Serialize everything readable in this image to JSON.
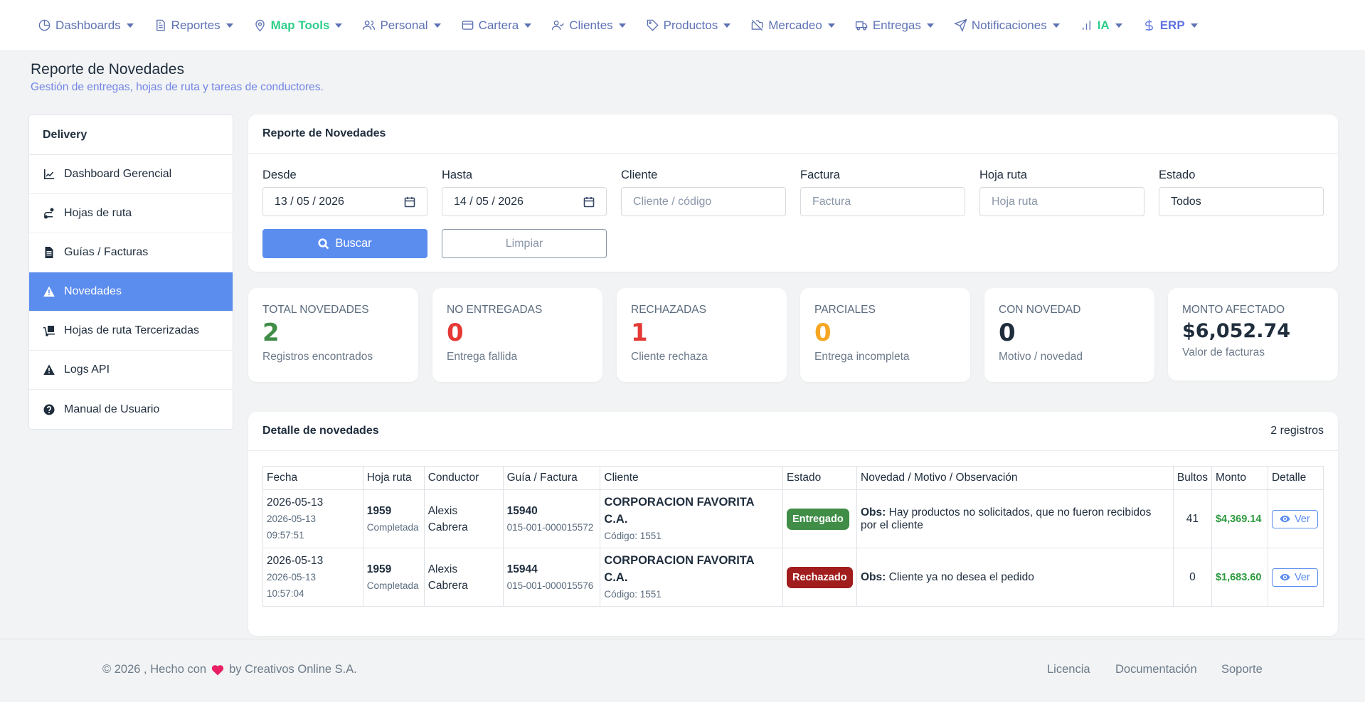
{
  "nav": {
    "items": [
      {
        "label": "Dashboards",
        "icon": "dashboard-icon"
      },
      {
        "label": "Reportes",
        "icon": "report-icon"
      },
      {
        "label": "Map Tools",
        "icon": "map-pin-icon"
      },
      {
        "label": "Personal",
        "icon": "users-icon"
      },
      {
        "label": "Cartera",
        "icon": "card-icon"
      },
      {
        "label": "Clientes",
        "icon": "user-check-icon"
      },
      {
        "label": "Productos",
        "icon": "tag-icon"
      },
      {
        "label": "Mercadeo",
        "icon": "camera-off-icon"
      },
      {
        "label": "Entregas",
        "icon": "truck-icon"
      },
      {
        "label": "Notificaciones",
        "icon": "send-icon"
      },
      {
        "label": "IA",
        "icon": "bars-icon"
      },
      {
        "label": "ERP",
        "icon": "dollar-icon"
      }
    ]
  },
  "page": {
    "title": "Reporte de Novedades",
    "subtitle": "Gestión de entregas, hojas de ruta y tareas de conductores."
  },
  "sidebar": {
    "title": "Delivery",
    "items": [
      {
        "label": "Dashboard Gerencial",
        "icon": "chart-line-icon"
      },
      {
        "label": "Hojas de ruta",
        "icon": "route-icon"
      },
      {
        "label": "Guías / Facturas",
        "icon": "file-invoice-icon"
      },
      {
        "label": "Novedades",
        "icon": "warning-icon"
      },
      {
        "label": "Hojas de ruta Tercerizadas",
        "icon": "dolly-icon"
      },
      {
        "label": "Logs API",
        "icon": "warning-icon"
      },
      {
        "label": "Manual de Usuario",
        "icon": "question-circle-icon"
      }
    ]
  },
  "filters": {
    "title": "Reporte de Novedades",
    "desde": {
      "label": "Desde",
      "value": "13 / 05 / 2026"
    },
    "hasta": {
      "label": "Hasta",
      "value": "14 / 05 / 2026"
    },
    "cliente": {
      "label": "Cliente",
      "placeholder": "Cliente / código"
    },
    "factura": {
      "label": "Factura",
      "placeholder": "Factura"
    },
    "hoja": {
      "label": "Hoja ruta",
      "placeholder": "Hoja ruta"
    },
    "estado": {
      "label": "Estado",
      "value": "Todos"
    },
    "buscar": "Buscar",
    "limpiar": "Limpiar"
  },
  "stats": [
    {
      "label": "TOTAL NOVEDADES",
      "value": "2",
      "sub": "Registros encontrados",
      "color": "#3f8d46"
    },
    {
      "label": "NO ENTREGADAS",
      "value": "0",
      "sub": "Entrega fallida",
      "color": "#e53935"
    },
    {
      "label": "RECHAZADAS",
      "value": "1",
      "sub": "Cliente rechaza",
      "color": "#e53935"
    },
    {
      "label": "PARCIALES",
      "value": "0",
      "sub": "Entrega incompleta",
      "color": "#f5a623"
    },
    {
      "label": "CON NOVEDAD",
      "value": "0",
      "sub": "Motivo / novedad",
      "color": "#1f2d3d"
    },
    {
      "label": "MONTO AFECTADO",
      "value": "$6,052.74",
      "sub": "Valor de facturas",
      "color": "#1f2d3d"
    }
  ],
  "detail": {
    "title": "Detalle de novedades",
    "count": "2 registros",
    "headers": [
      "Fecha",
      "Hoja ruta",
      "Conductor",
      "Guía / Factura",
      "Cliente",
      "Estado",
      "Novedad / Motivo / Observación",
      "Bultos",
      "Monto",
      "Detalle"
    ],
    "rows": [
      {
        "fecha": "2026-05-13",
        "fecha_sub": "2026-05-13",
        "hora": "09:57:51",
        "hoja": "1959",
        "hoja_estado": "Completada",
        "conductor1": "Alexis",
        "conductor2": "Cabrera",
        "guia": "15940",
        "factura": "015-001-000015572",
        "cliente": "CORPORACION FAVORITA C.A.",
        "codigo": "Código: 1551",
        "estado": "Entregado",
        "obs_label": "Obs:",
        "obs": "Hay productos no solicitados, que no fueron recibidos por el cliente",
        "bultos": "41",
        "monto": "$4,369.14",
        "ver": "Ver"
      },
      {
        "fecha": "2026-05-13",
        "fecha_sub": "2026-05-13",
        "hora": "10:57:04",
        "hoja": "1959",
        "hoja_estado": "Completada",
        "conductor1": "Alexis",
        "conductor2": "Cabrera",
        "guia": "15944",
        "factura": "015-001-000015576",
        "cliente": "CORPORACION FAVORITA C.A.",
        "codigo": "Código: 1551",
        "estado": "Rechazado",
        "obs_label": "Obs:",
        "obs": "Cliente ya no desea el pedido",
        "bultos": "0",
        "monto": "$1,683.60",
        "ver": "Ver"
      }
    ]
  },
  "footer": {
    "left1": "© 2026 , Hecho con",
    "left2": "by Creativos Online S.A.",
    "links": [
      "Licencia",
      "Documentación",
      "Soporte"
    ]
  }
}
